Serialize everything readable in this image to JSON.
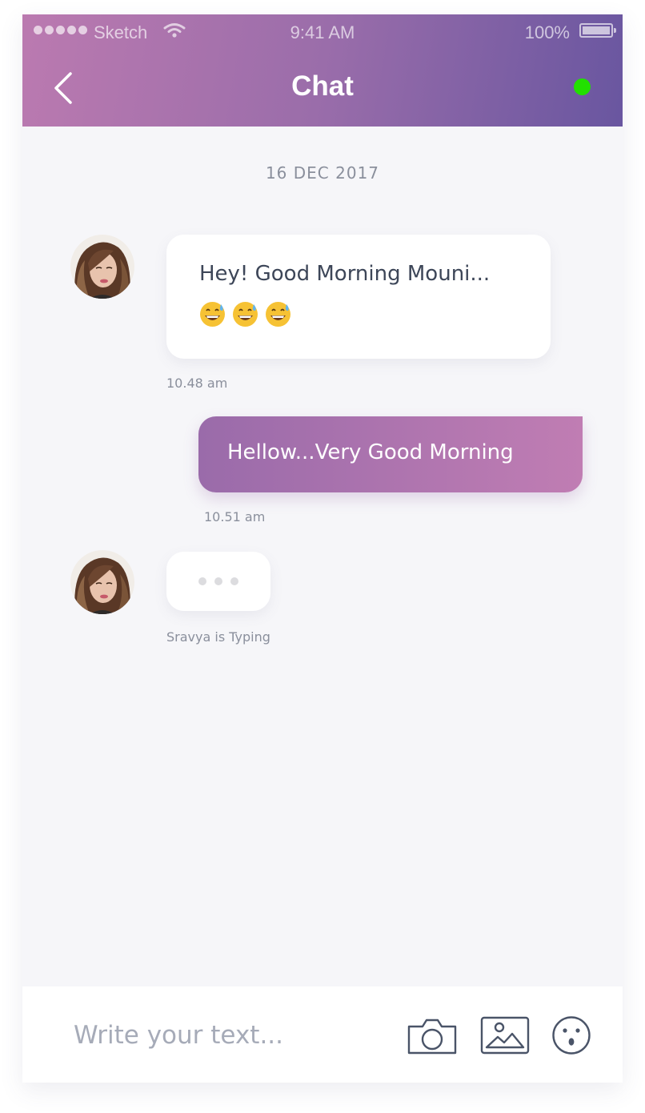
{
  "status_bar": {
    "carrier": "Sketch",
    "time": "9:41 AM",
    "battery": "100%"
  },
  "header": {
    "title": "Chat",
    "online_color": "#22e000",
    "back_icon": "chevron-left-icon"
  },
  "conversation": {
    "date": "16 DEC 2017",
    "messages": [
      {
        "from": "contact",
        "text": "Hey! Good Morning Mouni...",
        "emoji": "grinning-face-with-sweat-x3",
        "time": "10.48 am"
      },
      {
        "from": "me",
        "text": "Hellow...Very Good Morning",
        "time": "10.51 am"
      }
    ],
    "typing_status": "Sravya is Typing"
  },
  "composer": {
    "placeholder": "Write your text...",
    "icons": [
      "camera-icon",
      "image-icon",
      "emoji-icon"
    ]
  },
  "colors": {
    "header_gradient": [
      "#bb7ab0",
      "#6956a0"
    ],
    "outgoing_bubble": [
      "#9a6baa",
      "#c07db3"
    ],
    "background": "#f6f6f9",
    "text_dark": "#3d4658",
    "text_muted": "#8a8f9c"
  }
}
